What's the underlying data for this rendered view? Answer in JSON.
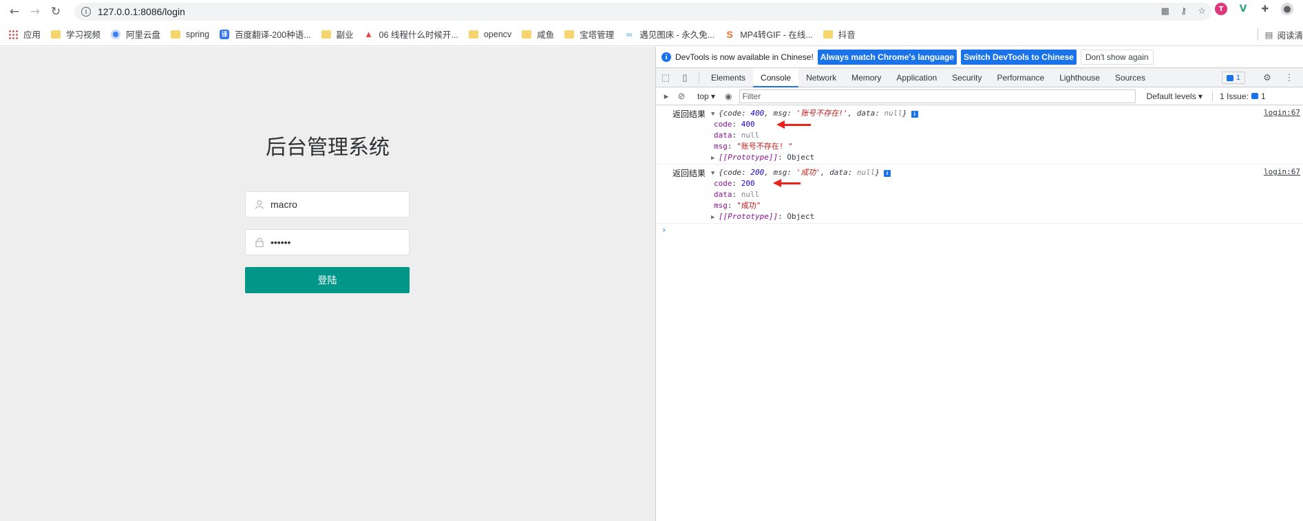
{
  "browser": {
    "url": "127.0.0.1:8086/login",
    "bookmarks": [
      {
        "label": "应用",
        "icon": "apps-icon"
      },
      {
        "label": "学习视频",
        "icon": "folder-icon"
      },
      {
        "label": "阿里云盘",
        "icon": "aliyun-icon"
      },
      {
        "label": "spring",
        "icon": "folder-icon"
      },
      {
        "label": "百度翻译-200种语...",
        "icon": "translate-icon"
      },
      {
        "label": "副业",
        "icon": "folder-icon"
      },
      {
        "label": "06 线程什么时候开...",
        "icon": "fire-icon"
      },
      {
        "label": "opencv",
        "icon": "folder-icon"
      },
      {
        "label": "咸鱼",
        "icon": "folder-icon"
      },
      {
        "label": "宝塔管理",
        "icon": "folder-icon"
      },
      {
        "label": "遇见图床 - 永久免...",
        "icon": "link-icon"
      },
      {
        "label": "MP4转GIF - 在线...",
        "icon": "mp4-icon"
      },
      {
        "label": "抖音",
        "icon": "folder-icon"
      }
    ],
    "reading_list": "阅读清"
  },
  "login": {
    "title": "后台管理系统",
    "username": "macro",
    "password": "••••••",
    "button": "登陆"
  },
  "devtools": {
    "info_text": "DevTools is now available in Chinese!",
    "btn_match": "Always match Chrome's language",
    "btn_switch": "Switch DevTools to Chinese",
    "btn_dont": "Don't show again",
    "tabs": [
      "Elements",
      "Console",
      "Network",
      "Memory",
      "Application",
      "Security",
      "Performance",
      "Lighthouse",
      "Sources"
    ],
    "active_tab": "Console",
    "message_count": "1",
    "context": "top",
    "filter_placeholder": "Filter",
    "levels": "Default levels",
    "issues": "1 Issue:",
    "issues_count": "1",
    "entries": [
      {
        "label": "返回结果",
        "source": "login:67",
        "summary": {
          "code": "400",
          "msg": "'账号不存在!'",
          "data": "null"
        },
        "code": "400",
        "data": "null",
        "msg": "\"账号不存在! \"",
        "proto": "Object"
      },
      {
        "label": "返回结果",
        "source": "login:67",
        "summary": {
          "code": "200",
          "msg": "'成功'",
          "data": "null"
        },
        "code": "200",
        "data": "null",
        "msg": "\"成功\"",
        "proto": "Object"
      }
    ]
  },
  "colors": {
    "accent": "#009688",
    "devtools_blue": "#1a73e8",
    "annotation_red": "#e8231c"
  }
}
